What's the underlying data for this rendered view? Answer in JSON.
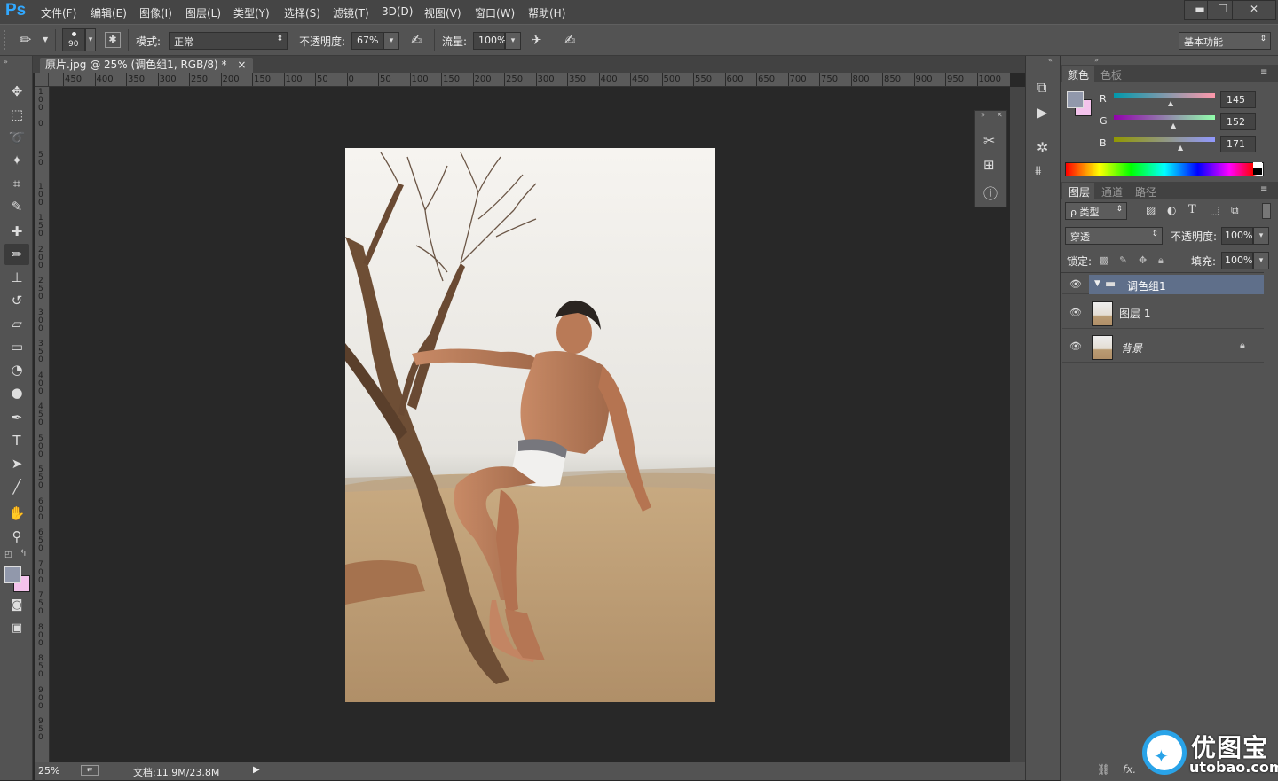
{
  "app": {
    "logo": "Ps"
  },
  "menu": [
    "文件(F)",
    "编辑(E)",
    "图像(I)",
    "图层(L)",
    "类型(Y)",
    "选择(S)",
    "滤镜(T)",
    "3D(D)",
    "视图(V)",
    "窗口(W)",
    "帮助(H)"
  ],
  "window_controls": {
    "minimize": "▬",
    "restore": "❐",
    "close": "✕"
  },
  "options": {
    "brush_size": "90",
    "mode_label": "模式:",
    "mode_value": "正常",
    "opacity_label": "不透明度:",
    "opacity_value": "67%",
    "flow_label": "流量:",
    "flow_value": "100%",
    "workspace": "基本功能"
  },
  "document": {
    "tab_title": "原片.jpg @ 25% (调色组1, RGB/8) *",
    "close": "×",
    "zoom": "25%",
    "doc_info": "文档:11.9M/23.8M"
  },
  "ruler": {
    "h_ticks": [
      "450",
      "400",
      "350",
      "300",
      "250",
      "200",
      "150",
      "100",
      "50",
      "0",
      "50",
      "100",
      "150",
      "200",
      "250",
      "300",
      "350",
      "400",
      "450",
      "500",
      "550",
      "600",
      "650",
      "700",
      "750",
      "800",
      "850",
      "900",
      "950",
      "1000"
    ],
    "v_ticks": [
      "100",
      "0",
      "50",
      "100",
      "150",
      "200",
      "250",
      "300",
      "350",
      "400",
      "450",
      "500",
      "550",
      "600",
      "650",
      "700",
      "750",
      "800",
      "850",
      "900",
      "950"
    ]
  },
  "tools": [
    {
      "name": "move-tool-icon",
      "glyph": "✥"
    },
    {
      "name": "marquee-tool-icon",
      "glyph": "⬚"
    },
    {
      "name": "lasso-tool-icon",
      "glyph": "➰"
    },
    {
      "name": "magic-wand-tool-icon",
      "glyph": "✦"
    },
    {
      "name": "crop-tool-icon",
      "glyph": "⌗"
    },
    {
      "name": "eyedropper-tool-icon",
      "glyph": "✎"
    },
    {
      "name": "healing-brush-tool-icon",
      "glyph": "✚"
    },
    {
      "name": "brush-tool-icon",
      "glyph": "✏"
    },
    {
      "name": "clone-stamp-tool-icon",
      "glyph": "⊥"
    },
    {
      "name": "history-brush-tool-icon",
      "glyph": "↺"
    },
    {
      "name": "eraser-tool-icon",
      "glyph": "▱"
    },
    {
      "name": "gradient-tool-icon",
      "glyph": "▭"
    },
    {
      "name": "blur-tool-icon",
      "glyph": "◔"
    },
    {
      "name": "dodge-tool-icon",
      "glyph": "●"
    },
    {
      "name": "pen-tool-icon",
      "glyph": "✒"
    },
    {
      "name": "type-tool-icon",
      "glyph": "T"
    },
    {
      "name": "path-selection-tool-icon",
      "glyph": "➤"
    },
    {
      "name": "line-tool-icon",
      "glyph": "╱"
    },
    {
      "name": "hand-tool-icon",
      "glyph": "✋"
    },
    {
      "name": "zoom-tool-icon",
      "glyph": "⚲"
    }
  ],
  "colors": {
    "foreground": "#9198ab",
    "background": "#f4c3ec",
    "panel_bg": "#535353",
    "selected_layer": "#5f6f8a"
  },
  "color_panel": {
    "tabs": [
      "颜色",
      "色板"
    ],
    "r_label": "R",
    "g_label": "G",
    "b_label": "B",
    "r_value": "145",
    "g_value": "152",
    "b_value": "171"
  },
  "layers_panel": {
    "tabs": [
      "图层",
      "通道",
      "路径"
    ],
    "filter_label": "ρ 类型",
    "blend_mode": "穿透",
    "opacity_label": "不透明度:",
    "opacity_value": "100%",
    "lock_label": "锁定:",
    "fill_label": "填充:",
    "fill_value": "100%",
    "layers": [
      {
        "name": "调色组1",
        "type": "group"
      },
      {
        "name": "图层 1",
        "type": "pixel"
      },
      {
        "name": "背景",
        "type": "background"
      }
    ],
    "footer_icons": [
      "link-icon",
      "fx-icon"
    ],
    "fx_label": "fx."
  },
  "watermark": {
    "text_cn": "优图宝",
    "text_url": "utobao.com"
  }
}
